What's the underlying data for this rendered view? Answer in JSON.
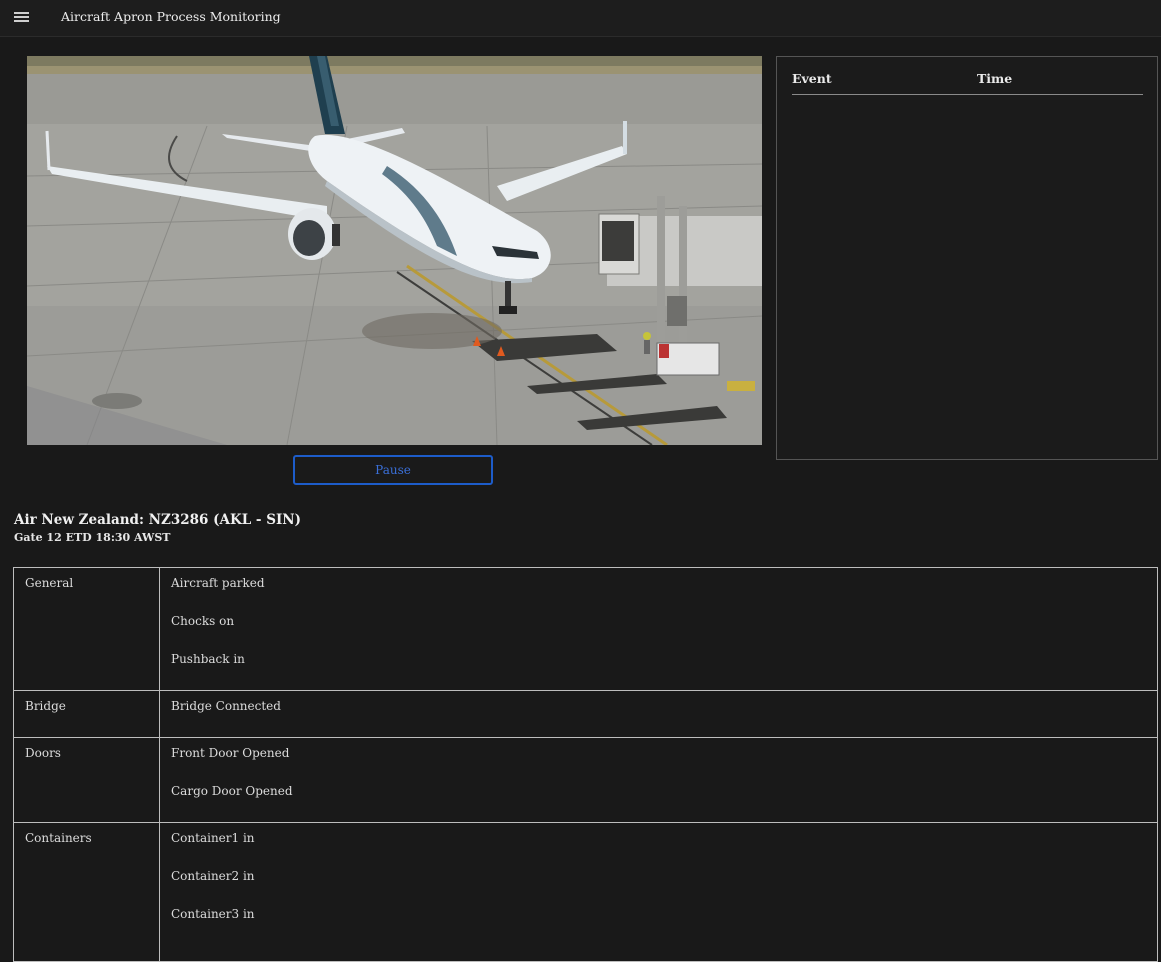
{
  "app": {
    "title": "Aircraft Apron Process Monitoring",
    "menu_icon": "hamburger-menu-icon"
  },
  "video": {
    "description_icon": "live-camera-feed",
    "pause_label": "Pause"
  },
  "event_log": {
    "columns": [
      "Event",
      "Time"
    ],
    "rows": []
  },
  "flight": {
    "title": "Air New Zealand: NZ3286 (AKL - SIN)",
    "subtitle": "Gate 12 ETD 18:30 AWST"
  },
  "status": [
    {
      "category": "General",
      "items": [
        "Aircraft parked",
        "Chocks on",
        "Pushback in"
      ]
    },
    {
      "category": "Bridge",
      "items": [
        "Bridge Connected"
      ]
    },
    {
      "category": "Doors",
      "items": [
        "Front Door Opened",
        "Cargo Door Opened"
      ]
    },
    {
      "category": "Containers",
      "items": [
        "Container1 in",
        "Container2 in",
        "Container3 in"
      ]
    }
  ],
  "colors": {
    "background": "#191919",
    "accent": "#1d5cc9",
    "border": "#bdbdbd"
  }
}
